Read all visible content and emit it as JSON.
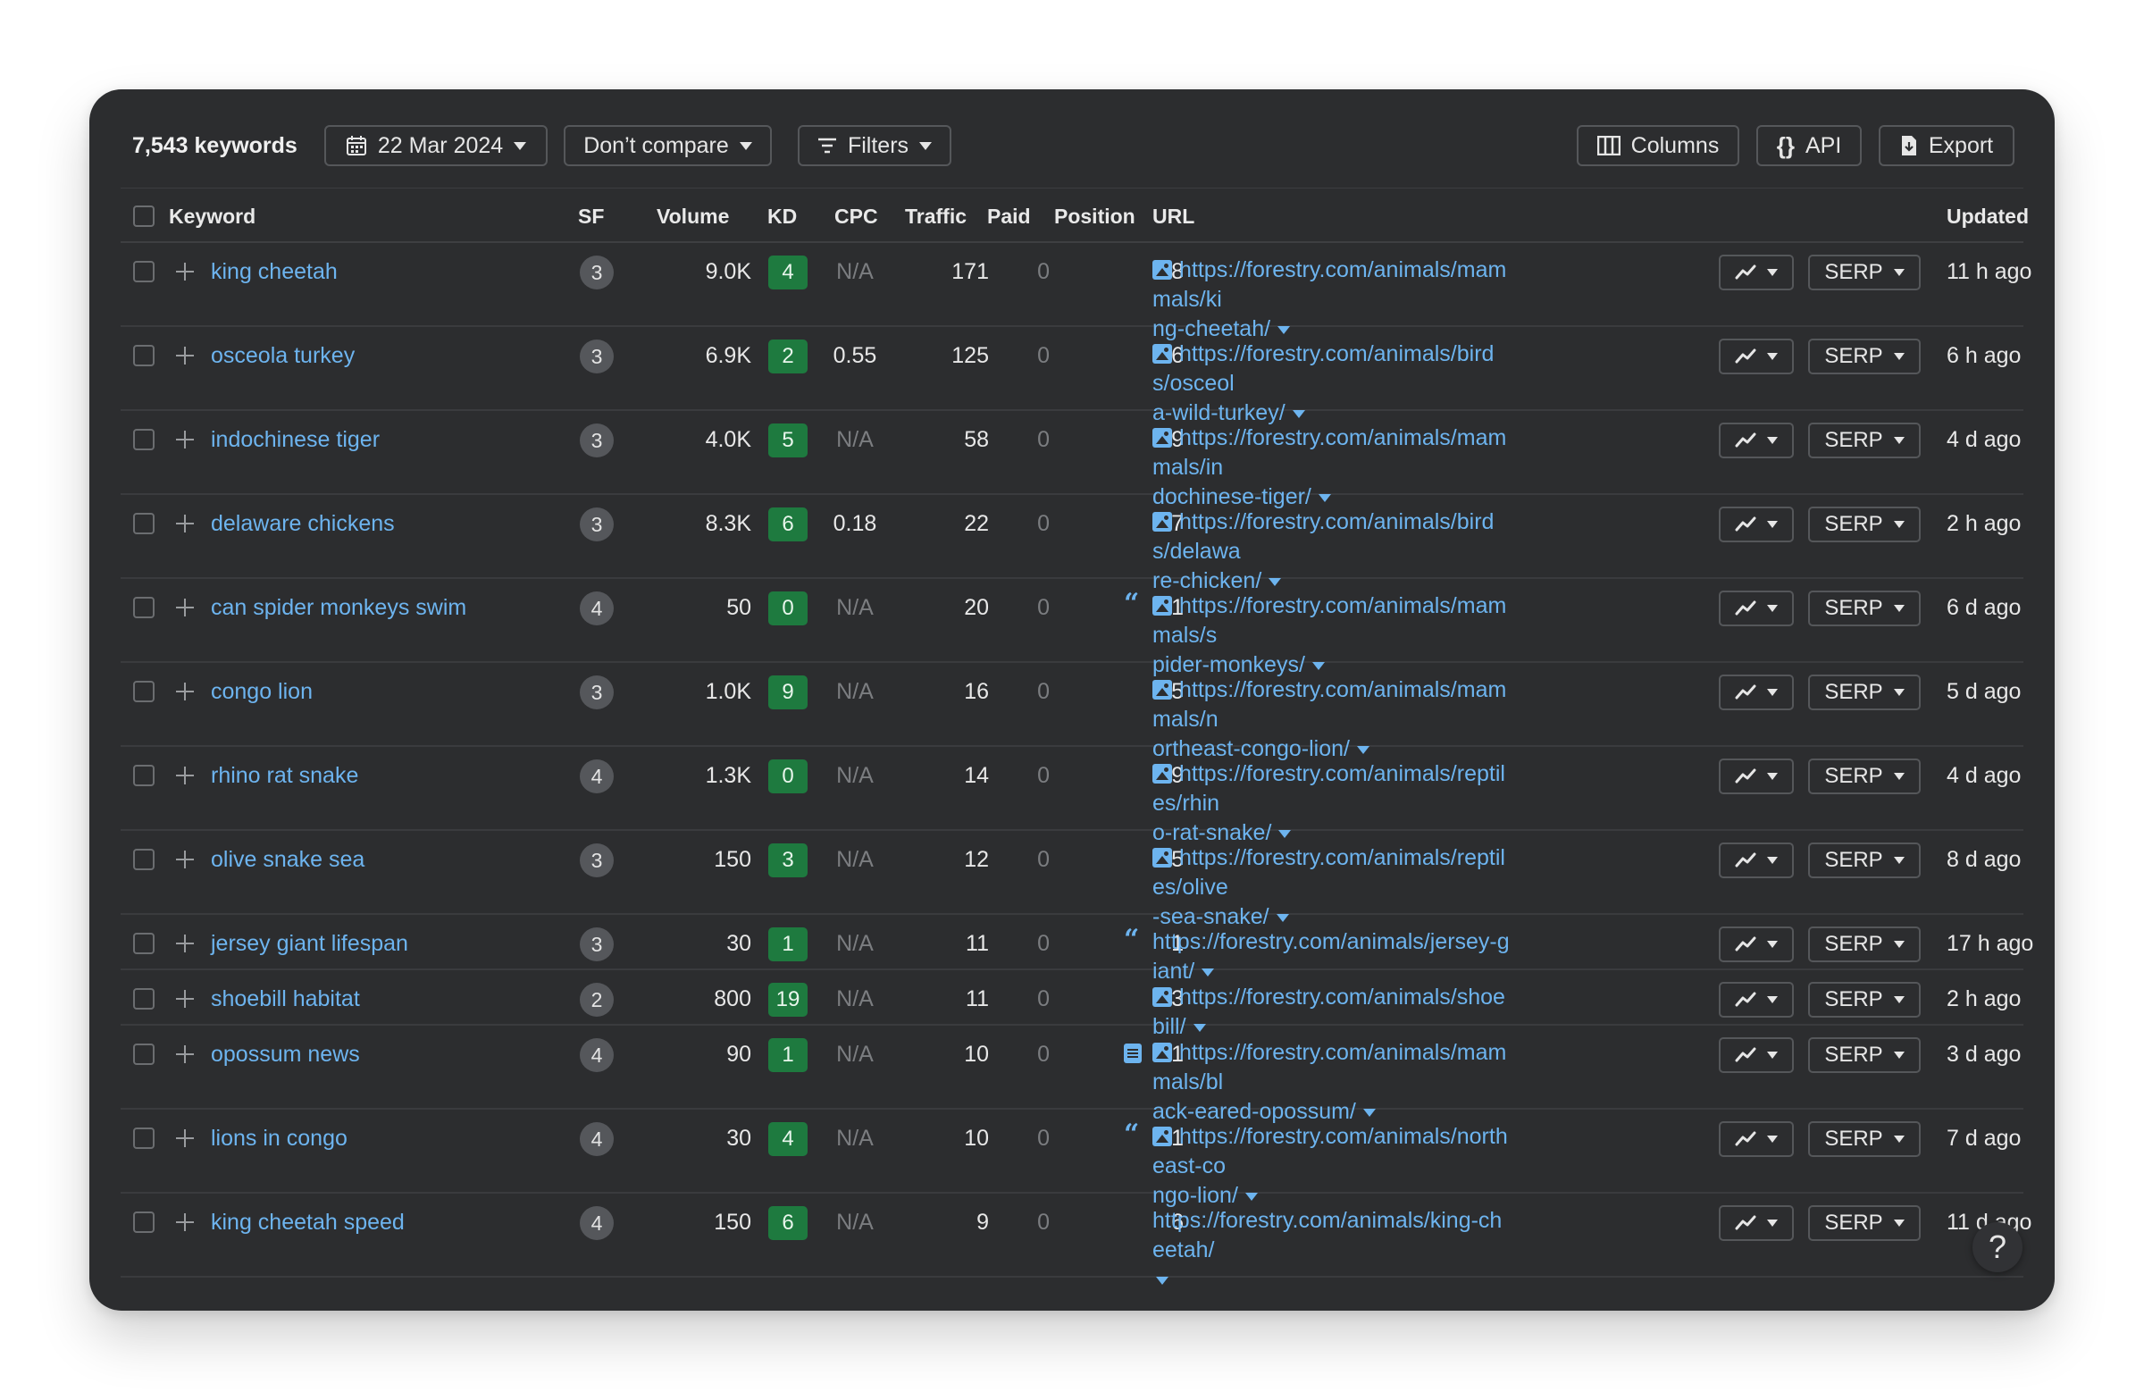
{
  "toolbar": {
    "keyword_count": "7,543 keywords",
    "date_label": "22 Mar 2024",
    "compare_label": "Don’t compare",
    "filters_label": "Filters",
    "columns_label": "Columns",
    "api_label": "API",
    "export_label": "Export"
  },
  "headers": {
    "keyword": "Keyword",
    "sf": "SF",
    "volume": "Volume",
    "kd": "KD",
    "cpc": "CPC",
    "traffic": "Traffic",
    "paid": "Paid",
    "position": "Position",
    "url": "URL",
    "updated": "Updated"
  },
  "serp_label": "SERP",
  "help_label": "?",
  "colors": {
    "panel_bg": "#2c2d2f",
    "link": "#6db4ef",
    "kd_badge": "#1e7a3f",
    "sf_badge": "#55575b"
  },
  "rows": [
    {
      "keyword": "king cheetah",
      "sf": "3",
      "volume": "9.0K",
      "kd": "4",
      "cpc": "N/A",
      "traffic": "171",
      "paid": "0",
      "position": "8",
      "lead_icon": "",
      "has_image_icon": true,
      "url_line1": "https://forestry.com/animals/mammals/ki",
      "url_line2": "ng-cheetah/",
      "updated": "11 h ago"
    },
    {
      "keyword": "osceola turkey",
      "sf": "3",
      "volume": "6.9K",
      "kd": "2",
      "cpc": "0.55",
      "traffic": "125",
      "paid": "0",
      "position": "6",
      "lead_icon": "",
      "has_image_icon": true,
      "url_line1": "https://forestry.com/animals/birds/osceol",
      "url_line2": "a-wild-turkey/",
      "updated": "6 h ago"
    },
    {
      "keyword": "indochinese tiger",
      "sf": "3",
      "volume": "4.0K",
      "kd": "5",
      "cpc": "N/A",
      "traffic": "58",
      "paid": "0",
      "position": "9",
      "lead_icon": "",
      "has_image_icon": true,
      "url_line1": "https://forestry.com/animals/mammals/in",
      "url_line2": "dochinese-tiger/",
      "updated": "4 d ago"
    },
    {
      "keyword": "delaware chickens",
      "sf": "3",
      "volume": "8.3K",
      "kd": "6",
      "cpc": "0.18",
      "traffic": "22",
      "paid": "0",
      "position": "17",
      "lead_icon": "",
      "has_image_icon": true,
      "url_line1": "https://forestry.com/animals/birds/delawa",
      "url_line2": "re-chicken/",
      "updated": "2 h ago"
    },
    {
      "keyword": "can spider monkeys swim",
      "sf": "4",
      "volume": "50",
      "kd": "0",
      "cpc": "N/A",
      "traffic": "20",
      "paid": "0",
      "position": "1",
      "lead_icon": "quote",
      "has_image_icon": true,
      "url_line1": "https://forestry.com/animals/mammals/s",
      "url_line2": "pider-monkeys/",
      "updated": "6 d ago"
    },
    {
      "keyword": "congo lion",
      "sf": "3",
      "volume": "1.0K",
      "kd": "9",
      "cpc": "N/A",
      "traffic": "16",
      "paid": "0",
      "position": "5",
      "lead_icon": "",
      "has_image_icon": true,
      "url_line1": "https://forestry.com/animals/mammals/n",
      "url_line2": "ortheast-congo-lion/",
      "updated": "5 d ago"
    },
    {
      "keyword": "rhino rat snake",
      "sf": "4",
      "volume": "1.3K",
      "kd": "0",
      "cpc": "N/A",
      "traffic": "14",
      "paid": "0",
      "position": "9",
      "lead_icon": "",
      "has_image_icon": true,
      "url_line1": "https://forestry.com/animals/reptiles/rhin",
      "url_line2": "o-rat-snake/",
      "updated": "4 d ago"
    },
    {
      "keyword": "olive snake sea",
      "sf": "3",
      "volume": "150",
      "kd": "3",
      "cpc": "N/A",
      "traffic": "12",
      "paid": "0",
      "position": "5",
      "lead_icon": "",
      "has_image_icon": true,
      "url_line1": "https://forestry.com/animals/reptiles/olive",
      "url_line2": "-sea-snake/",
      "updated": "8 d ago"
    },
    {
      "keyword": "jersey giant lifespan",
      "sf": "3",
      "volume": "30",
      "kd": "1",
      "cpc": "N/A",
      "traffic": "11",
      "paid": "0",
      "position": "1",
      "lead_icon": "quote",
      "has_image_icon": false,
      "url_line1": "https://forestry.com/animals/jersey-giant/",
      "url_line2": "",
      "updated": "17 h ago"
    },
    {
      "keyword": "shoebill habitat",
      "sf": "2",
      "volume": "800",
      "kd": "19",
      "cpc": "N/A",
      "traffic": "11",
      "paid": "0",
      "position": "13",
      "lead_icon": "",
      "has_image_icon": true,
      "url_line1": "https://forestry.com/animals/shoebill/",
      "url_line2": "",
      "updated": "2 h ago"
    },
    {
      "keyword": "opossum news",
      "sf": "4",
      "volume": "90",
      "kd": "1",
      "cpc": "N/A",
      "traffic": "10",
      "paid": "0",
      "position": "1",
      "lead_icon": "doc",
      "has_image_icon": true,
      "url_line1": "https://forestry.com/animals/mammals/bl",
      "url_line2": "ack-eared-opossum/",
      "updated": "3 d ago"
    },
    {
      "keyword": "lions in congo",
      "sf": "4",
      "volume": "30",
      "kd": "4",
      "cpc": "N/A",
      "traffic": "10",
      "paid": "0",
      "position": "1",
      "lead_icon": "quote",
      "has_image_icon": true,
      "url_line1": "https://forestry.com/animals/northeast-co",
      "url_line2": "ngo-lion/",
      "updated": "7 d ago"
    },
    {
      "keyword": "king cheetah speed",
      "sf": "4",
      "volume": "150",
      "kd": "6",
      "cpc": "N/A",
      "traffic": "9",
      "paid": "0",
      "position": "6",
      "lead_icon": "",
      "has_image_icon": false,
      "url_line1": "https://forestry.com/animals/king-cheetah/",
      "url_line2": "",
      "url_caret_below": true,
      "updated": "11 d ago"
    }
  ]
}
